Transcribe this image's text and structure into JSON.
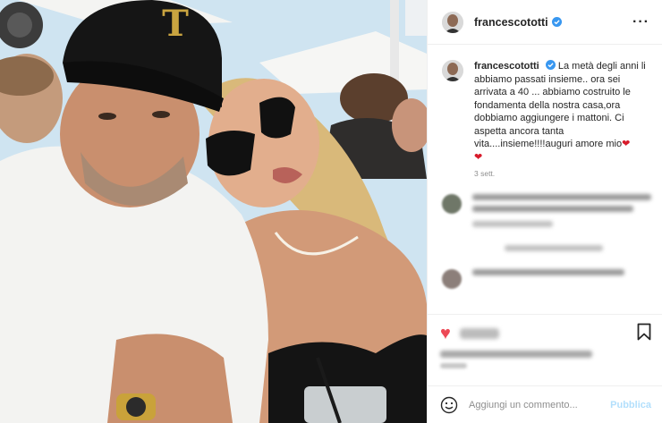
{
  "post": {
    "username": "francescototti",
    "caption_user": "francescototti",
    "caption": "La metà degli anni li abbiamo passati insieme.. ora sei arrivata a 40 ... abbiamo costruito le fondamenta della nostra casa,ora dobbiamo aggiungere i mattoni. Ci aspetta ancora tanta vita....insieme!!!!auguri amore mio",
    "caption_emoji": "❤",
    "caption_emoji_2": "❤",
    "time": "3 sett."
  },
  "cap_logo": "T",
  "add_comment": {
    "placeholder": "Aggiungi un commento...",
    "post_label": "Pubblica"
  },
  "icons": {
    "more": "more-options-icon",
    "verified": "verified-badge-icon",
    "like": "heart-icon",
    "save": "bookmark-icon",
    "emoji": "emoji-icon"
  },
  "colors": {
    "verified": "#3897f0",
    "like": "#ed4956",
    "post_button": "#b2dffc",
    "muted": "#8e8e8e"
  }
}
